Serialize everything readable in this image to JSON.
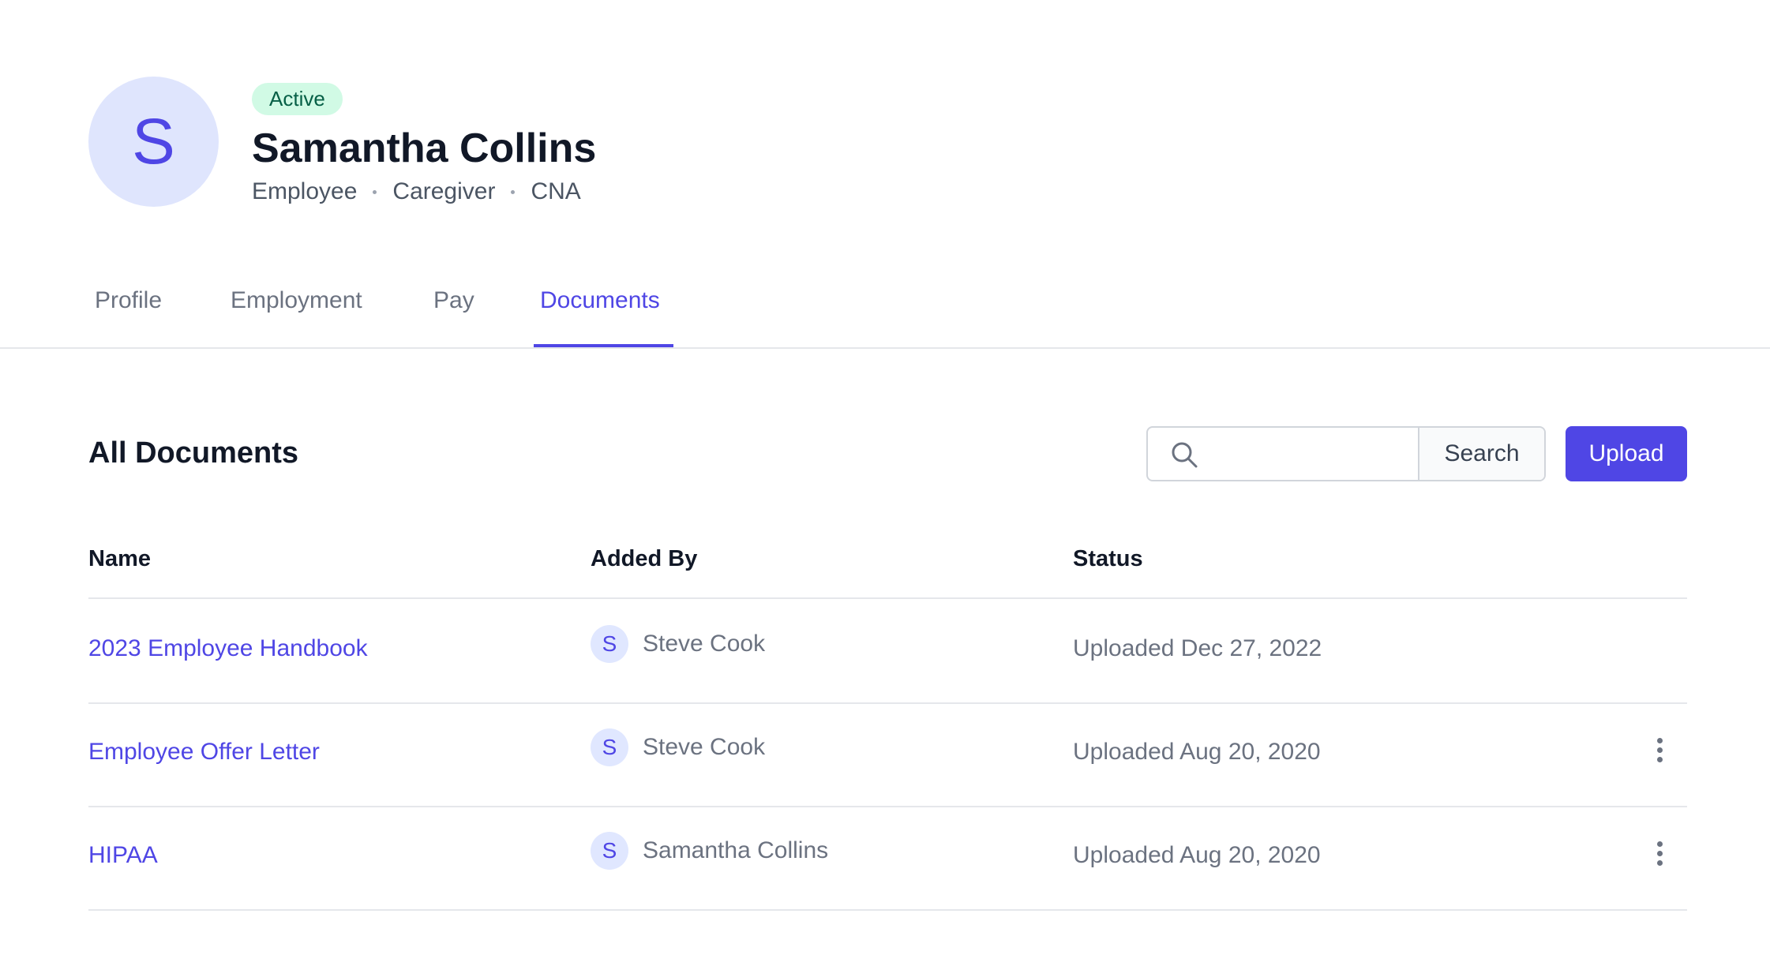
{
  "profile": {
    "avatar_initial": "S",
    "status": "Active",
    "name": "Samantha Collins",
    "roles": [
      "Employee",
      "Caregiver",
      "CNA"
    ]
  },
  "tabs": [
    {
      "label": "Profile"
    },
    {
      "label": "Employment"
    },
    {
      "label": "Pay"
    },
    {
      "label": "Documents",
      "active": true
    }
  ],
  "documents": {
    "title": "All Documents",
    "search": {
      "placeholder": "",
      "button_label": "Search"
    },
    "upload_label": "Upload",
    "columns": {
      "name": "Name",
      "added_by": "Added By",
      "status": "Status"
    },
    "rows": [
      {
        "name": "2023 Employee Handbook",
        "added_by_initial": "S",
        "added_by": "Steve Cook",
        "status": "Uploaded Dec 27, 2022",
        "has_menu": false
      },
      {
        "name": "Employee Offer Letter",
        "added_by_initial": "S",
        "added_by": "Steve Cook",
        "status": "Uploaded Aug 20, 2020",
        "has_menu": true
      },
      {
        "name": "HIPAA",
        "added_by_initial": "S",
        "added_by": "Samantha Collins",
        "status": "Uploaded Aug 20, 2020",
        "has_menu": true
      }
    ]
  },
  "colors": {
    "accent": "#4f46e5",
    "badge_bg": "#d1fae5",
    "badge_text": "#065f46"
  }
}
